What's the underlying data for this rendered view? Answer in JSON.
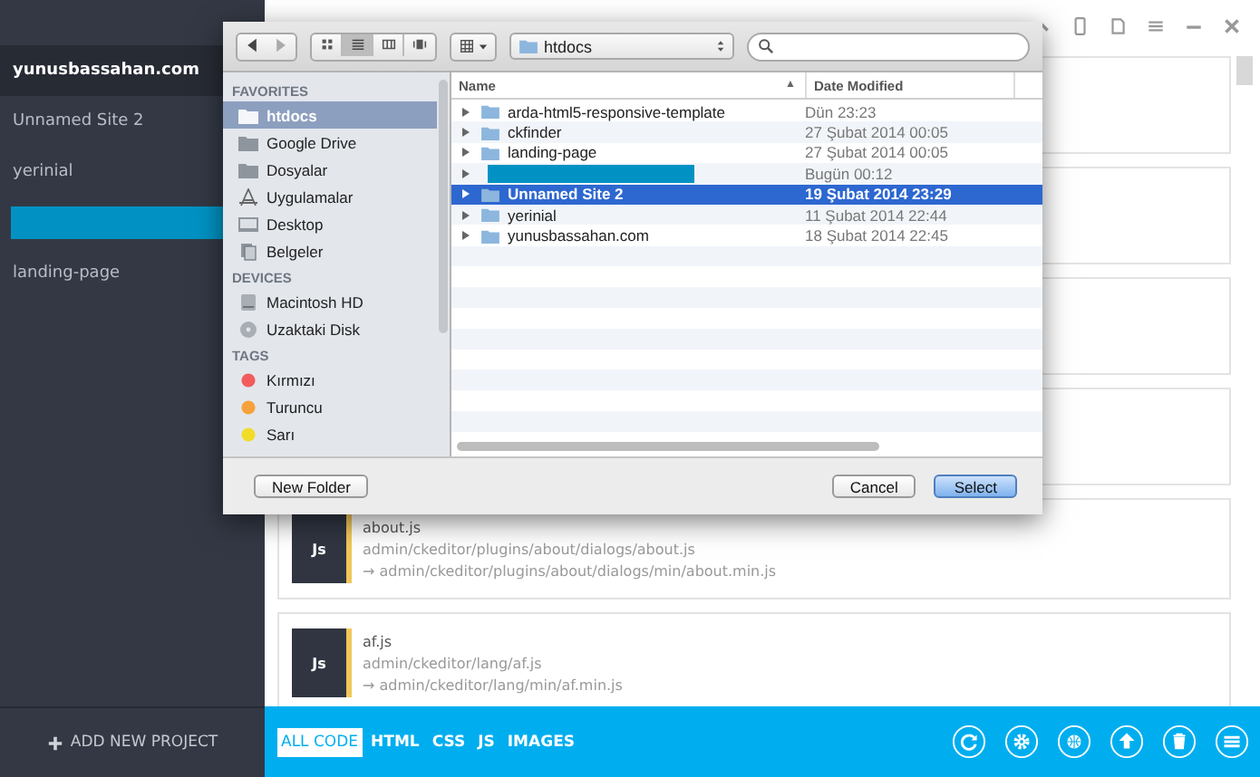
{
  "sidebar": {
    "items": [
      {
        "kind": "site",
        "label": "yunusbassahan.com",
        "selected": true
      },
      {
        "kind": "site",
        "label": "Unnamed Site 2",
        "selected": false
      },
      {
        "kind": "site",
        "label": "yerinial",
        "selected": false
      },
      {
        "kind": "masked",
        "selected": false
      },
      {
        "kind": "site",
        "label": "landing-page",
        "selected": false
      }
    ],
    "add_button": "ADD NEW PROJECT"
  },
  "files": [
    {
      "name": "about.js",
      "badge": "Js",
      "source": "admin/ckeditor/plugins/about/dialogs/about.js",
      "output": "→ admin/ckeditor/plugins/about/dialogs/min/about.min.js"
    },
    {
      "name": "af.js",
      "badge": "Js",
      "source": "admin/ckeditor/lang/af.js",
      "output": "→ admin/ckeditor/lang/min/af.min.js"
    }
  ],
  "filters": [
    {
      "label": "ALL CODE",
      "selected": true
    },
    {
      "label": "HTML",
      "selected": false
    },
    {
      "label": "CSS",
      "selected": false
    },
    {
      "label": "JS",
      "selected": false
    },
    {
      "label": "IMAGES",
      "selected": false
    }
  ],
  "dialog": {
    "view_modes": [
      {
        "kind": "icons",
        "selected": false
      },
      {
        "kind": "list",
        "selected": true
      },
      {
        "kind": "columns",
        "selected": false
      },
      {
        "kind": "coverflow",
        "selected": false
      }
    ],
    "location": "htdocs",
    "sections": [
      {
        "title": "FAVORITES",
        "items": [
          {
            "kind": "folder",
            "label": "htdocs",
            "selected": true
          },
          {
            "kind": "folder",
            "label": "Google Drive",
            "selected": false
          },
          {
            "kind": "folder",
            "label": "Dosyalar",
            "selected": false
          },
          {
            "kind": "apps",
            "label": "Uygulamalar",
            "selected": false
          },
          {
            "kind": "desktop",
            "label": "Desktop",
            "selected": false
          },
          {
            "kind": "documents",
            "label": "Belgeler",
            "selected": false
          }
        ]
      },
      {
        "title": "DEVICES",
        "items": [
          {
            "kind": "drive",
            "label": "Macintosh HD",
            "selected": false
          },
          {
            "kind": "disc",
            "label": "Uzaktaki Disk",
            "selected": false
          }
        ]
      },
      {
        "title": "TAGS",
        "items": [
          {
            "kind": "tag",
            "label": "Kırmızı",
            "color": "#f25c5c",
            "selected": false
          },
          {
            "kind": "tag",
            "label": "Turuncu",
            "color": "#f7a13a",
            "selected": false
          },
          {
            "kind": "tag",
            "label": "Sarı",
            "color": "#f1dc2a",
            "selected": false
          }
        ]
      }
    ],
    "columns": [
      {
        "label": "Name",
        "sort": "▲"
      },
      {
        "label": "Date Modified"
      }
    ],
    "rows": [
      {
        "kind": "folder",
        "name": "arda-html5-responsive-template",
        "date": "Dün 23:23",
        "selected": false
      },
      {
        "kind": "folder",
        "name": "ckfinder",
        "date": "27 Şubat 2014 00:05",
        "selected": false
      },
      {
        "kind": "folder",
        "name": "landing-page",
        "date": "27 Şubat 2014 00:05",
        "selected": false
      },
      {
        "kind": "masked",
        "date": "Bugün 00:12",
        "selected": false
      },
      {
        "kind": "folder",
        "name": "Unnamed Site 2",
        "date": "19 Şubat 2014 23:29",
        "selected": true
      },
      {
        "kind": "folder",
        "name": "yerinial",
        "date": "11 Şubat 2014 22:44",
        "selected": false
      },
      {
        "kind": "folder",
        "name": "yunusbassahan.com",
        "date": "18 Şubat 2014 22:45",
        "selected": false
      }
    ],
    "buttons": [
      {
        "kind": "secondary",
        "label": "New Folder"
      },
      {
        "kind": "cancel",
        "label": "Cancel"
      },
      {
        "kind": "default",
        "label": "Select"
      }
    ]
  }
}
